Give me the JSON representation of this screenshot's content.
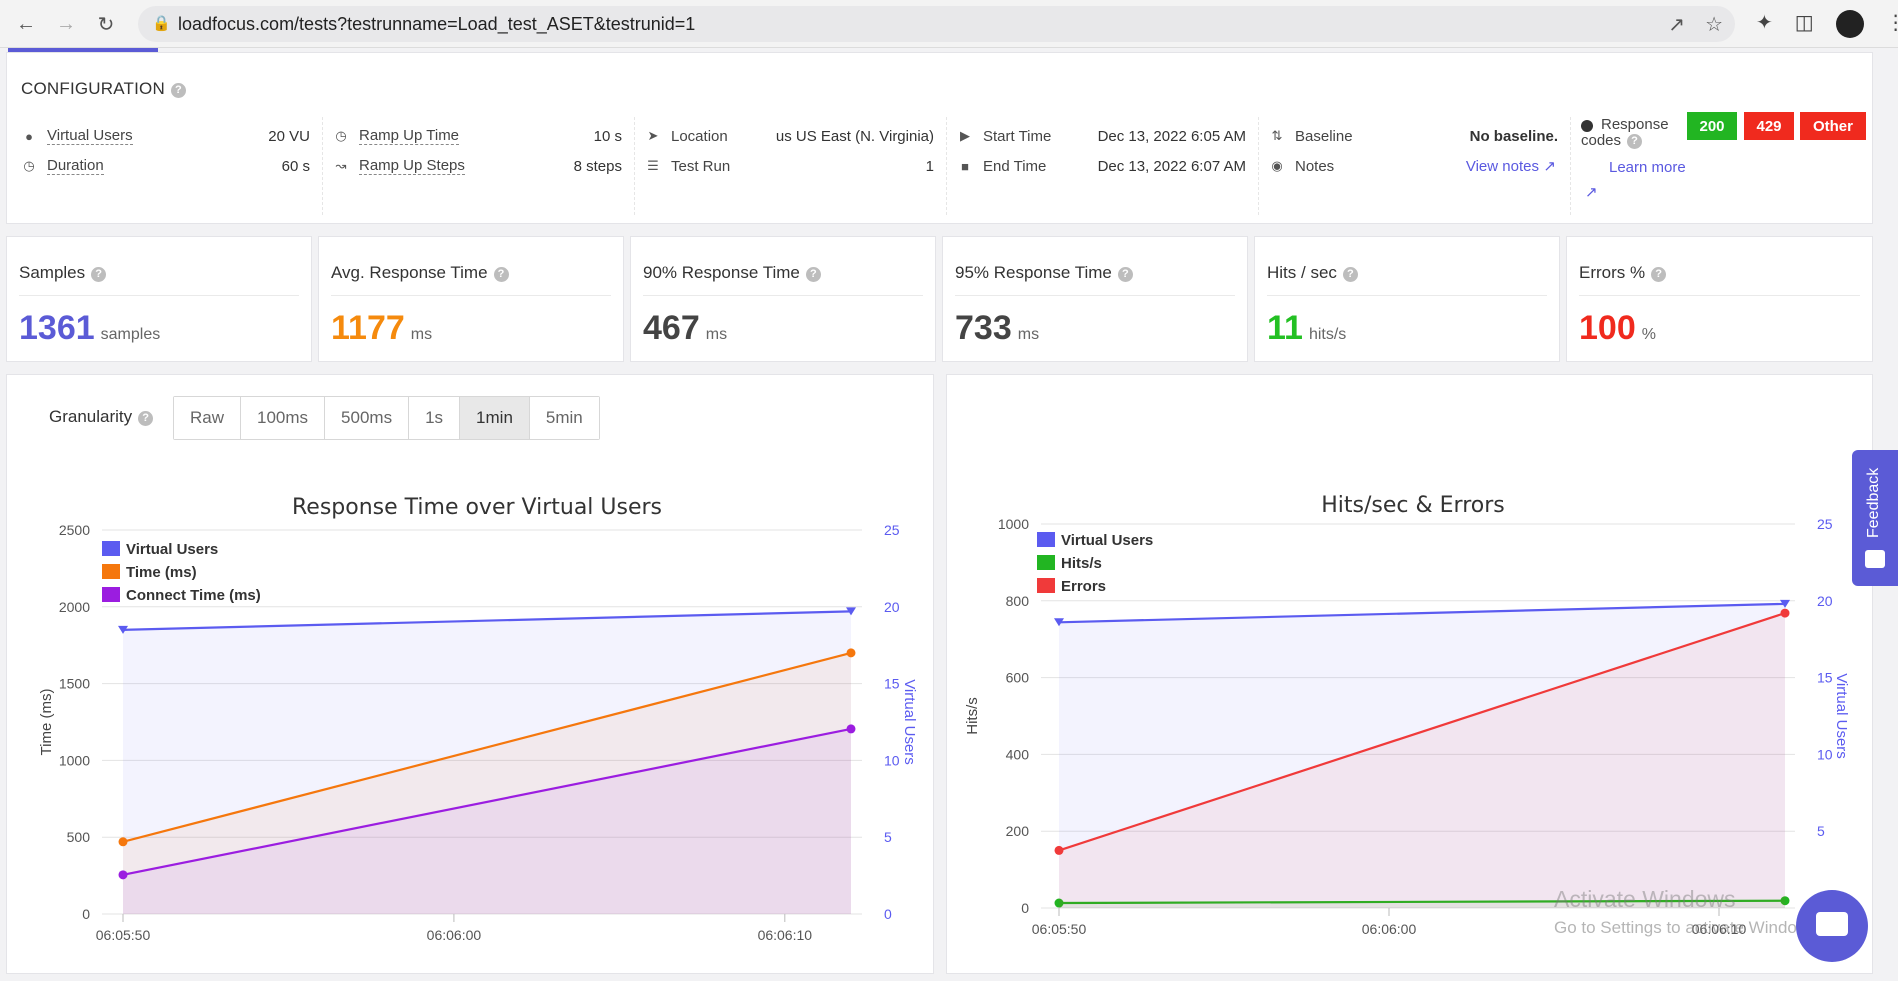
{
  "browser": {
    "url": "loadfocus.com/tests?testrunname=Load_test_ASET&testrunid=1"
  },
  "config": {
    "title": "CONFIGURATION",
    "virtual_users": {
      "label": "Virtual Users",
      "value": "20 VU"
    },
    "duration": {
      "label": "Duration",
      "value": "60 s"
    },
    "ramp_up_time": {
      "label": "Ramp Up Time",
      "value": "10 s"
    },
    "ramp_up_steps": {
      "label": "Ramp Up Steps",
      "value": "8 steps"
    },
    "location": {
      "label": "Location",
      "value": "us US East (N. Virginia)"
    },
    "test_run": {
      "label": "Test Run",
      "value": "1"
    },
    "start_time": {
      "label": "Start Time",
      "value": "Dec 13, 2022 6:05 AM"
    },
    "end_time": {
      "label": "End Time",
      "value": "Dec 13, 2022 6:07 AM"
    },
    "baseline": {
      "label": "Baseline",
      "value": "No baseline."
    },
    "notes": {
      "label": "Notes",
      "link": "View notes"
    },
    "response_codes": {
      "label1": "Response",
      "label2": "codes",
      "learn_more": "Learn more",
      "codes": [
        {
          "label": "200",
          "color": "#22b522"
        },
        {
          "label": "429",
          "color": "#f02a1e"
        },
        {
          "label": "Other",
          "color": "#f02a1e"
        }
      ]
    }
  },
  "stats": [
    {
      "title": "Samples",
      "value": "1361",
      "unit": "samples",
      "color": "#5b5bd6"
    },
    {
      "title": "Avg. Response Time",
      "value": "1177",
      "unit": "ms",
      "color": "#f58a0d"
    },
    {
      "title": "90% Response Time",
      "value": "467",
      "unit": "ms",
      "color": "#444444"
    },
    {
      "title": "95% Response Time",
      "value": "733",
      "unit": "ms",
      "color": "#444444"
    },
    {
      "title": "Hits / sec",
      "value": "11",
      "unit": "hits/s",
      "color": "#23c023"
    },
    {
      "title": "Errors %",
      "value": "100",
      "unit": "%",
      "color": "#f02a1e"
    }
  ],
  "granularity": {
    "label": "Granularity",
    "options": [
      "Raw",
      "100ms",
      "500ms",
      "1s",
      "1min",
      "5min"
    ],
    "selected": "1min"
  },
  "feedback": "Feedback",
  "watermark": {
    "line1": "Activate Windows",
    "line2": "Go to Settings to activate Windows."
  },
  "chart_data": [
    {
      "type": "line",
      "title": "Response Time over Virtual Users",
      "ylabel": "Time (ms)",
      "y2label": "Virtual Users",
      "x": [
        "06:05:50",
        "06:06:12"
      ],
      "xticks": [
        "06:05:50",
        "06:06:00",
        "06:06:10"
      ],
      "ylim": [
        0,
        2500
      ],
      "yticks": [
        0,
        500,
        1000,
        1500,
        2000,
        2500
      ],
      "y2lim": [
        0,
        25
      ],
      "y2ticks": [
        0,
        5,
        10,
        15,
        20,
        25
      ],
      "legend_position": "top-left",
      "series": [
        {
          "name": "Virtual Users",
          "axis": "right",
          "values": [
            18.5,
            19.7
          ],
          "color": "#5b5bf0"
        },
        {
          "name": "Time (ms)",
          "axis": "left",
          "values": [
            470,
            1700
          ],
          "color": "#f5770d"
        },
        {
          "name": "Connect Time (ms)",
          "axis": "left",
          "values": [
            255,
            1205
          ],
          "color": "#9b1de0"
        }
      ]
    },
    {
      "type": "line",
      "title": "Hits/sec & Errors",
      "ylabel": "Hits/s",
      "y2label": "Virtual Users",
      "x": [
        "06:05:50",
        "06:06:12"
      ],
      "xticks": [
        "06:05:50",
        "06:06:00",
        "06:06:10"
      ],
      "ylim": [
        0,
        1000
      ],
      "yticks": [
        0,
        200,
        400,
        600,
        800,
        1000
      ],
      "y2lim": [
        0,
        25
      ],
      "y2ticks": [
        5,
        10,
        15,
        20,
        25
      ],
      "legend_position": "top-left",
      "series": [
        {
          "name": "Virtual Users",
          "axis": "right",
          "values": [
            18.6,
            19.8
          ],
          "color": "#5b5bf0"
        },
        {
          "name": "Hits/s",
          "axis": "left",
          "values": [
            13,
            19
          ],
          "color": "#22b522"
        },
        {
          "name": "Errors",
          "axis": "left",
          "values": [
            150,
            768
          ],
          "color": "#f03a3a"
        }
      ]
    }
  ]
}
